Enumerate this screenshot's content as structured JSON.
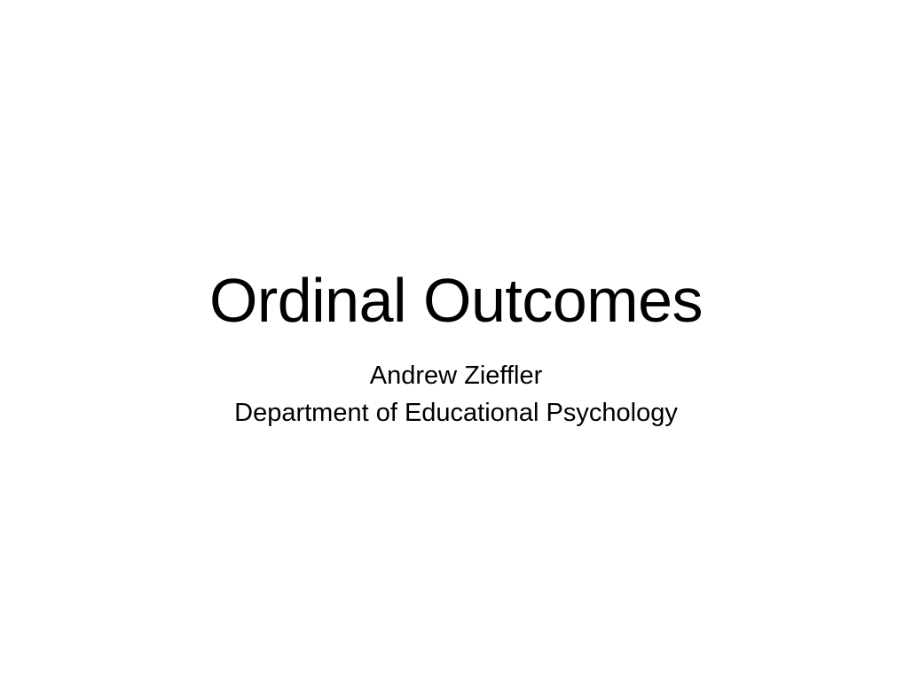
{
  "slide": {
    "title": "Ordinal Outcomes",
    "author": "Andrew Zieffler",
    "affiliation": "Department of Educational Psychology"
  }
}
